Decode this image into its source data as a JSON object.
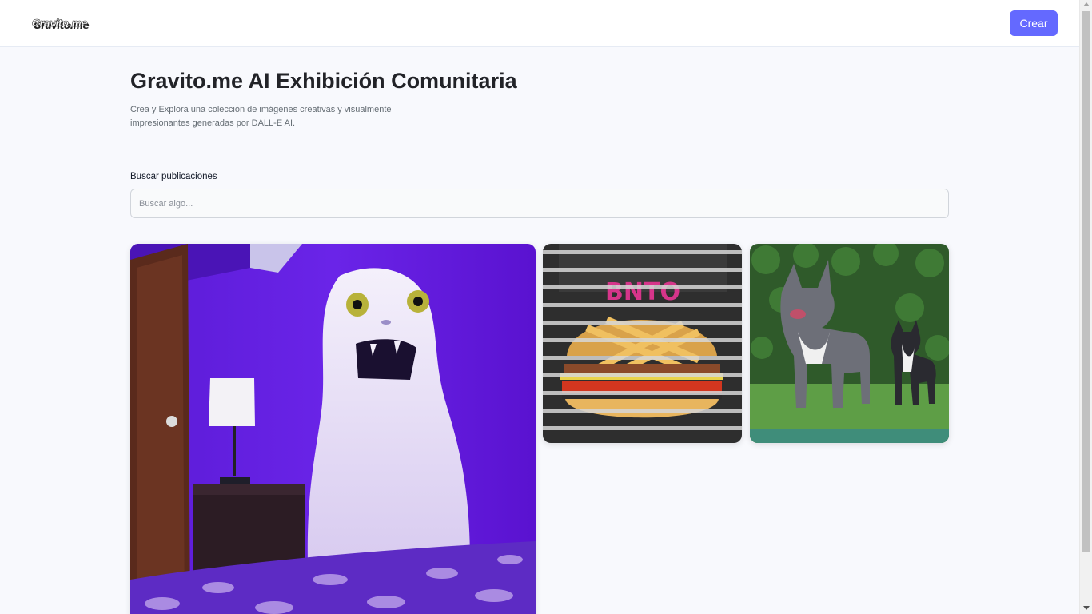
{
  "header": {
    "logo_text": "Gravito.me",
    "create_label": "Crear"
  },
  "hero": {
    "title": "Gravito.me AI Exhibición Comunitaria",
    "subtitle": "Crea y Explora una colección de imágenes creativas y visualmente impresionantes generadas por DALL-E AI."
  },
  "search": {
    "label": "Buscar publicaciones",
    "placeholder": "Buscar algo...",
    "value": ""
  },
  "posts": [
    {
      "subject": "ghost"
    },
    {
      "subject": "burger",
      "sign_text": "BNTO"
    },
    {
      "subject": "dogs"
    }
  ],
  "colors": {
    "accent": "#6469ff",
    "page_bg": "#f8f9fd"
  }
}
